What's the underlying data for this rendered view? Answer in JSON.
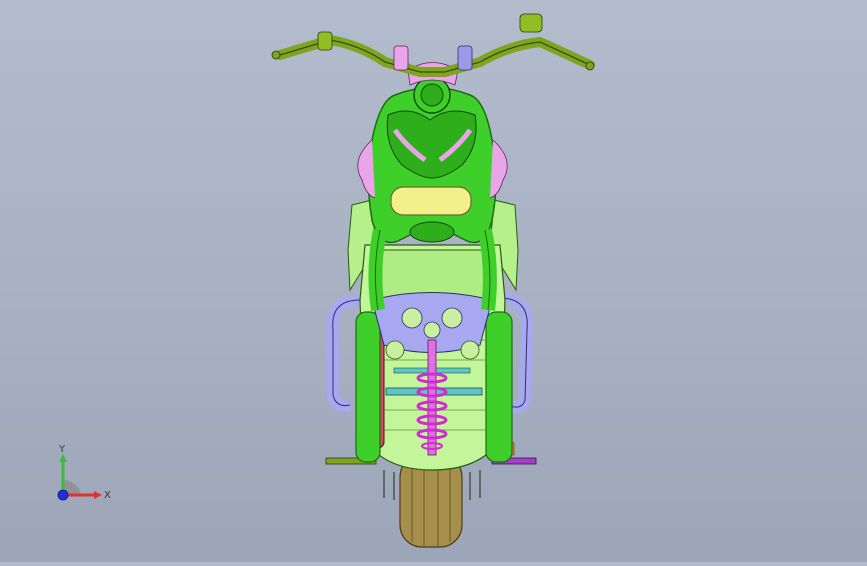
{
  "viewport": {
    "model": "motorcycle-top-view",
    "colors": {
      "frame_green": "#3fcf2a",
      "frame_dark": "#1d6b12",
      "body_light_green": "#b5f08a",
      "tank_yellow": "#f2f08a",
      "handlebar_olive": "#7ea51f",
      "pink_parts": "#e8a6e8",
      "spring_magenta": "#d22ad2",
      "swingarm_lavender": "#a8a8f0",
      "tire_khaki": "#a58f4a",
      "disc_red": "#d04a5a",
      "cyan_axle": "#5fc6c6"
    }
  },
  "triad": {
    "y_label": "Y",
    "x_label": "X",
    "colors": {
      "y": "#3dbb3d",
      "x": "#e03030",
      "z": "#2030e0"
    }
  }
}
